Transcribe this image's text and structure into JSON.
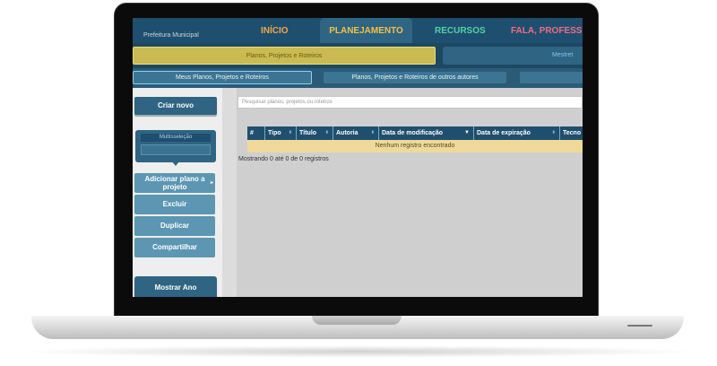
{
  "header": {
    "brand": "Prefeitura Municipal",
    "nav": [
      {
        "label": "INÍCIO",
        "color": "#f0a64a"
      },
      {
        "label": "PLANEJAMENTO",
        "color": "#f5c146"
      },
      {
        "label": "RECURSOS",
        "color": "#4fd3a6"
      },
      {
        "label": "FALA, PROFESS...",
        "color": "#f06b86"
      }
    ]
  },
  "subnav": {
    "primary": "Planos, Projetos e Roteiros",
    "secondary": "Mestret"
  },
  "tabs": {
    "mine": "Meus Planos, Projetos e Roteiros",
    "others": "Planos, Projetos e Roteiros de outros autores"
  },
  "sidebar": {
    "create": "Criar novo",
    "multiselect": "Multisseleção",
    "add_to_project": "Adicionar plano a projeto",
    "delete": "Excluir",
    "duplicate": "Duplicar",
    "share": "Compartilhar",
    "show_year": "Mostrar Ano"
  },
  "search": {
    "placeholder": "Pesquisar planos, projetos ou roteiros"
  },
  "table": {
    "columns": [
      "#",
      "Tipo",
      "Título",
      "Autoria",
      "Data de modificação",
      "Data de expiração",
      "Tecno"
    ],
    "empty": "Nenhum registro encontrado",
    "summary": "Mostrando 0 até 0 de 0 registros"
  },
  "colors": {
    "primary": "#1f4f6e",
    "accent": "#c9bb52",
    "empty_row": "#efd99a"
  }
}
